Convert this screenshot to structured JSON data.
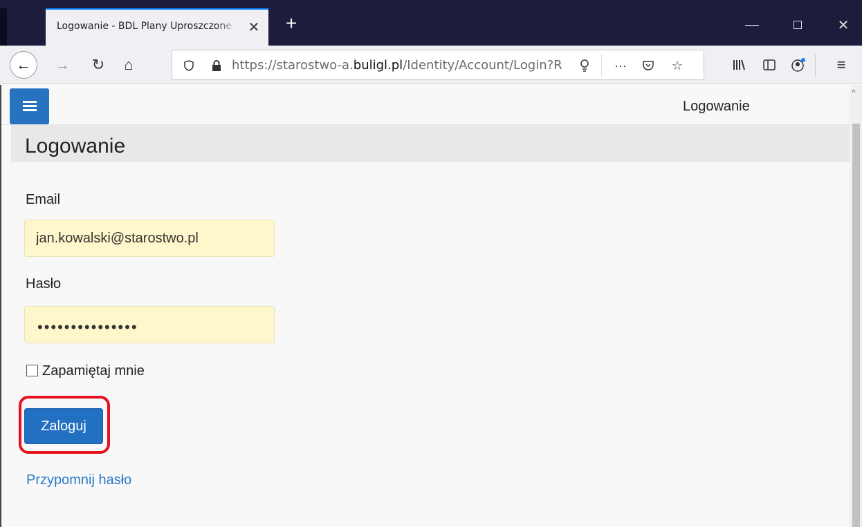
{
  "browser": {
    "tab_title": "Logowanie - BDL Plany Uproszczone",
    "url_prefix": "https://starostwo-a.",
    "url_domain": "buligl.pl",
    "url_path": "/Identity/Account/Login?R",
    "icons": [
      "back-icon",
      "forward-icon",
      "reload-icon",
      "home-icon",
      "shield-icon",
      "lock-icon",
      "lightbulb-icon",
      "more-icon",
      "pocket-icon",
      "star-icon",
      "library-icon",
      "sidebar-icon",
      "account-icon",
      "menu-icon"
    ]
  },
  "app": {
    "topbar_title": "Logowanie",
    "page_title": "Logowanie"
  },
  "form": {
    "email_label": "Email",
    "email_value": "jan.kowalski@starostwo.pl",
    "password_label": "Hasło",
    "password_masked": "•••••••••••••••",
    "remember_label": "Zapamiętaj mnie",
    "remember_checked": false,
    "login_button": "Zaloguj",
    "forgot_link": "Przypomnij hasło"
  },
  "colors": {
    "primary": "#2270c2",
    "autofill_bg": "#fef7cb",
    "highlight": "#e8101e",
    "link": "#2a7bc6"
  }
}
